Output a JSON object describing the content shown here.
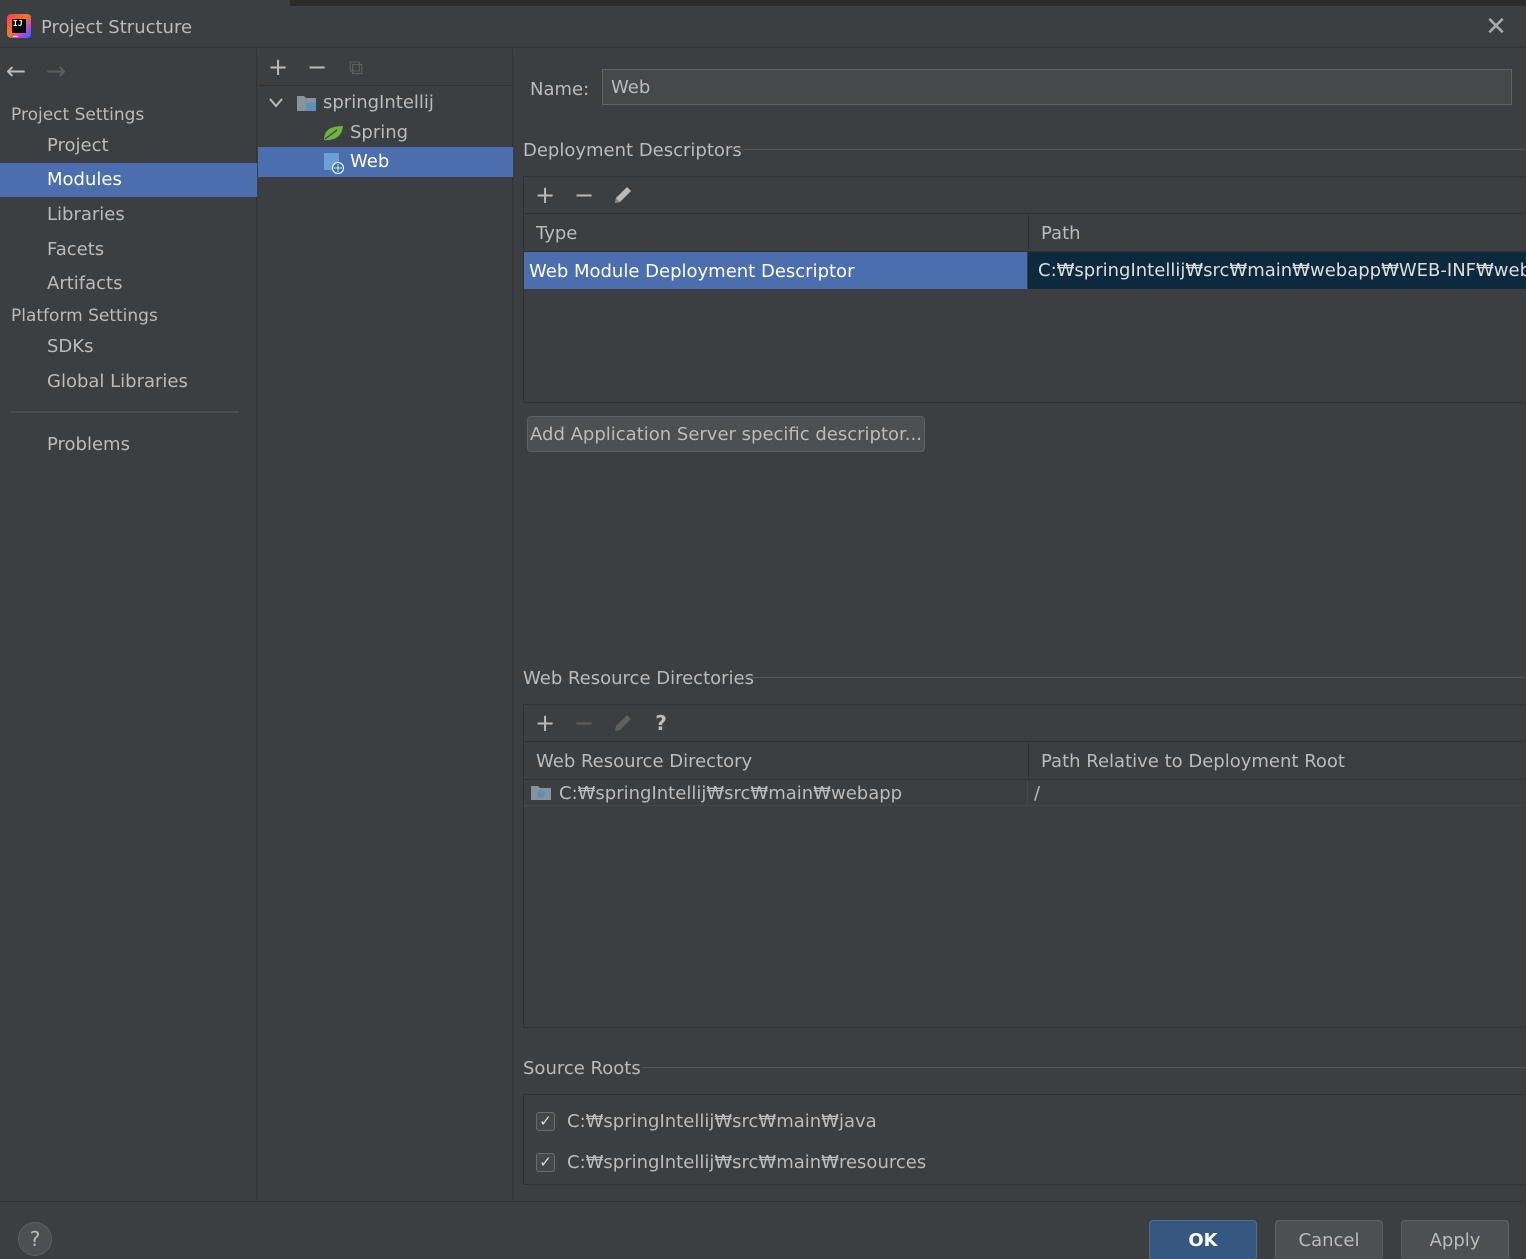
{
  "window": {
    "title": "Project Structure",
    "close_symbol": "✕"
  },
  "sidebar": {
    "back_symbol": "←",
    "forward_symbol": "→",
    "project_settings_label": "Project Settings",
    "platform_settings_label": "Platform Settings",
    "items": [
      {
        "label": "Project"
      },
      {
        "label": "Modules",
        "selected": true
      },
      {
        "label": "Libraries"
      },
      {
        "label": "Facets"
      },
      {
        "label": "Artifacts"
      },
      {
        "label": "SDKs"
      },
      {
        "label": "Global Libraries"
      },
      {
        "label": "Problems"
      }
    ]
  },
  "tree": {
    "toolbar": {
      "add": "+",
      "remove": "−",
      "copy": "⧉"
    },
    "root": {
      "label": "springIntellij",
      "expanded": true
    },
    "children": [
      {
        "label": "Spring",
        "icon": "spring-leaf-icon"
      },
      {
        "label": "Web",
        "icon": "web-module-icon",
        "selected": true
      }
    ]
  },
  "content": {
    "name_label": "Name:",
    "name_value": "Web",
    "deployment": {
      "title": "Deployment Descriptors",
      "toolbar": {
        "add": "+",
        "remove": "−"
      },
      "columns": [
        "Type",
        "Path"
      ],
      "rows": [
        {
          "type": "Web Module Deployment Descriptor",
          "path": "C:₩springIntellij₩src₩main₩webapp₩WEB-INF₩web.xml"
        }
      ],
      "add_server_button": "Add Application Server specific descriptor..."
    },
    "web_resources": {
      "title": "Web Resource Directories",
      "toolbar": {
        "add": "+",
        "remove": "−",
        "help": "?"
      },
      "columns": [
        "Web Resource Directory",
        "Path Relative to Deployment Root"
      ],
      "rows": [
        {
          "directory": "C:₩springIntellij₩src₩main₩webapp",
          "relative_path": "/"
        }
      ]
    },
    "source_roots": {
      "title": "Source Roots",
      "items": [
        {
          "path": "C:₩springIntellij₩src₩main₩java",
          "checked": true
        },
        {
          "path": "C:₩springIntellij₩src₩main₩resources",
          "checked": true
        }
      ]
    }
  },
  "footer": {
    "help": "?",
    "ok": "OK",
    "cancel": "Cancel",
    "apply": "Apply"
  },
  "colors": {
    "background": "#3c3f41",
    "selection": "#4b6eaf",
    "selection_inactive": "#0d293e",
    "ok_button": "#365880"
  }
}
